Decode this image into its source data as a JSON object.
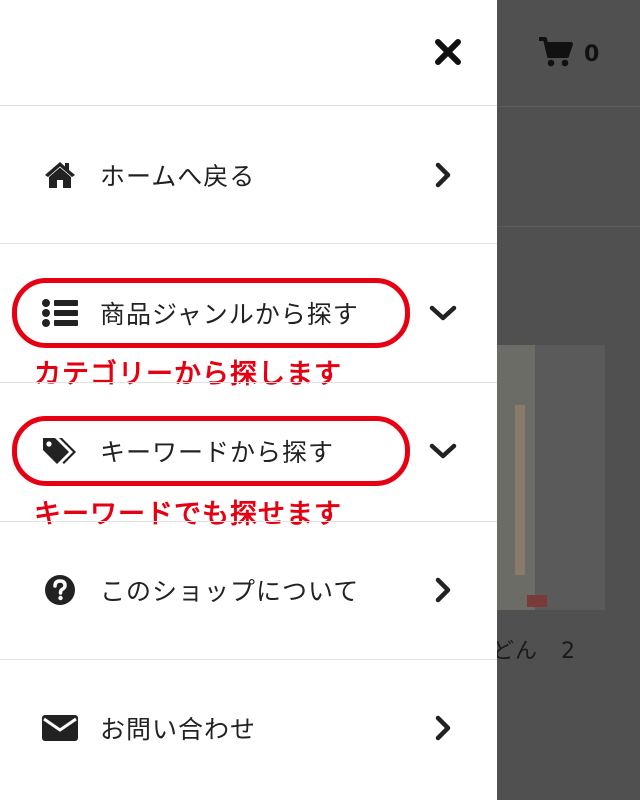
{
  "cart": {
    "icon": "cart-icon",
    "count": "0"
  },
  "background": {
    "product_name": "どん　2"
  },
  "drawer": {
    "close_icon": "close-icon",
    "items": [
      {
        "label": "ホームへ戻る",
        "icon": "home-icon",
        "chevron": "chevron-right-icon"
      },
      {
        "label": "商品ジャンルから探す",
        "icon": "list-icon",
        "chevron": "chevron-down-icon"
      },
      {
        "label": "キーワードから探す",
        "icon": "tags-icon",
        "chevron": "chevron-down-icon"
      },
      {
        "label": "このショップについて",
        "icon": "question-circle-icon",
        "chevron": "chevron-right-icon"
      },
      {
        "label": "お問い合わせ",
        "icon": "envelope-icon",
        "chevron": "chevron-right-icon"
      }
    ]
  },
  "annotations": {
    "category": "カテゴリーから探します",
    "keyword": "キーワードでも探せます"
  },
  "colors": {
    "annotation": "#e60012",
    "overlay": "#505050",
    "drawer": "#ffffff"
  }
}
